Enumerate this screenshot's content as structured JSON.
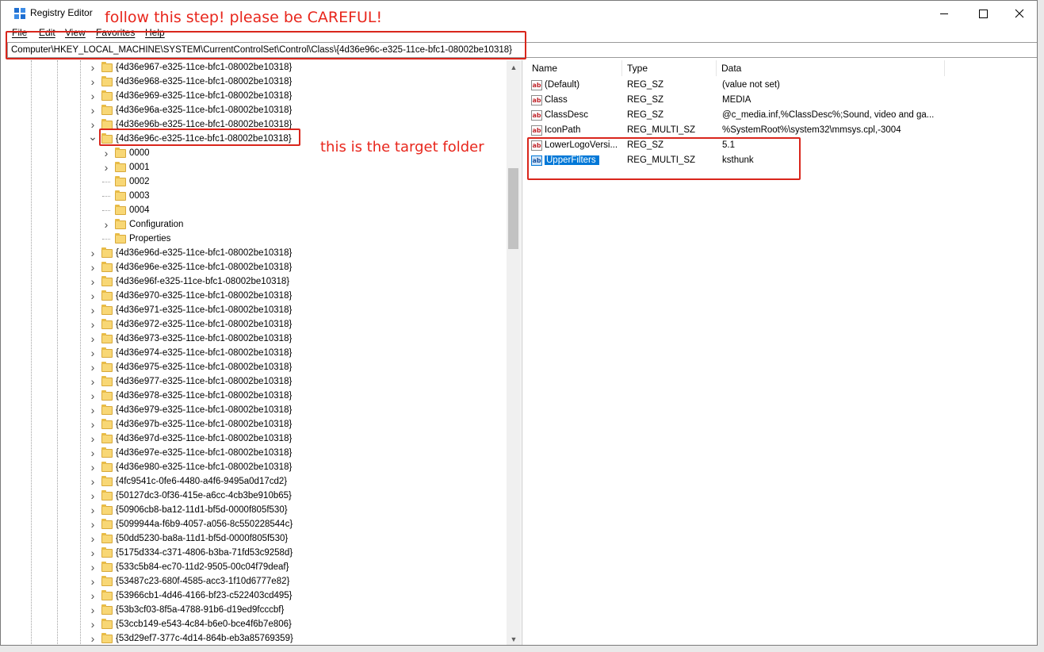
{
  "window": {
    "title": "Registry Editor"
  },
  "annotations": {
    "top_note": "follow this step!  please be CAREFUL!",
    "target_note": "this is the target folder"
  },
  "menu": [
    "File",
    "Edit",
    "View",
    "Favorites",
    "Help"
  ],
  "address": "Computer\\HKEY_LOCAL_MACHINE\\SYSTEM\\CurrentControlSet\\Control\\Class\\{4d36e96c-e325-11ce-bfc1-08002be10318}",
  "tree": [
    {
      "label": "{4d36e967-e325-11ce-bfc1-08002be10318}",
      "level": 1,
      "expander": ">"
    },
    {
      "label": "{4d36e968-e325-11ce-bfc1-08002be10318}",
      "level": 1,
      "expander": ">"
    },
    {
      "label": "{4d36e969-e325-11ce-bfc1-08002be10318}",
      "level": 1,
      "expander": ">"
    },
    {
      "label": "{4d36e96a-e325-11ce-bfc1-08002be10318}",
      "level": 1,
      "expander": ">"
    },
    {
      "label": "{4d36e96b-e325-11ce-bfc1-08002be10318}",
      "level": 1,
      "expander": ">"
    },
    {
      "label": "{4d36e96c-e325-11ce-bfc1-08002be10318}",
      "level": 1,
      "expander": "v",
      "target": true
    },
    {
      "label": "0000",
      "level": 2,
      "expander": ">"
    },
    {
      "label": "0001",
      "level": 2,
      "expander": ">"
    },
    {
      "label": "0002",
      "level": 2,
      "expander": ""
    },
    {
      "label": "0003",
      "level": 2,
      "expander": ""
    },
    {
      "label": "0004",
      "level": 2,
      "expander": ""
    },
    {
      "label": "Configuration",
      "level": 2,
      "expander": ">"
    },
    {
      "label": "Properties",
      "level": 2,
      "expander": ""
    },
    {
      "label": "{4d36e96d-e325-11ce-bfc1-08002be10318}",
      "level": 1,
      "expander": ">"
    },
    {
      "label": "{4d36e96e-e325-11ce-bfc1-08002be10318}",
      "level": 1,
      "expander": ">"
    },
    {
      "label": "{4d36e96f-e325-11ce-bfc1-08002be10318}",
      "level": 1,
      "expander": ">"
    },
    {
      "label": "{4d36e970-e325-11ce-bfc1-08002be10318}",
      "level": 1,
      "expander": ">"
    },
    {
      "label": "{4d36e971-e325-11ce-bfc1-08002be10318}",
      "level": 1,
      "expander": ">"
    },
    {
      "label": "{4d36e972-e325-11ce-bfc1-08002be10318}",
      "level": 1,
      "expander": ">"
    },
    {
      "label": "{4d36e973-e325-11ce-bfc1-08002be10318}",
      "level": 1,
      "expander": ">"
    },
    {
      "label": "{4d36e974-e325-11ce-bfc1-08002be10318}",
      "level": 1,
      "expander": ">"
    },
    {
      "label": "{4d36e975-e325-11ce-bfc1-08002be10318}",
      "level": 1,
      "expander": ">"
    },
    {
      "label": "{4d36e977-e325-11ce-bfc1-08002be10318}",
      "level": 1,
      "expander": ">"
    },
    {
      "label": "{4d36e978-e325-11ce-bfc1-08002be10318}",
      "level": 1,
      "expander": ">"
    },
    {
      "label": "{4d36e979-e325-11ce-bfc1-08002be10318}",
      "level": 1,
      "expander": ">"
    },
    {
      "label": "{4d36e97b-e325-11ce-bfc1-08002be10318}",
      "level": 1,
      "expander": ">"
    },
    {
      "label": "{4d36e97d-e325-11ce-bfc1-08002be10318}",
      "level": 1,
      "expander": ">"
    },
    {
      "label": "{4d36e97e-e325-11ce-bfc1-08002be10318}",
      "level": 1,
      "expander": ">"
    },
    {
      "label": "{4d36e980-e325-11ce-bfc1-08002be10318}",
      "level": 1,
      "expander": ">"
    },
    {
      "label": "{4fc9541c-0fe6-4480-a4f6-9495a0d17cd2}",
      "level": 1,
      "expander": ">"
    },
    {
      "label": "{50127dc3-0f36-415e-a6cc-4cb3be910b65}",
      "level": 1,
      "expander": ">"
    },
    {
      "label": "{50906cb8-ba12-11d1-bf5d-0000f805f530}",
      "level": 1,
      "expander": ">"
    },
    {
      "label": "{5099944a-f6b9-4057-a056-8c550228544c}",
      "level": 1,
      "expander": ">"
    },
    {
      "label": "{50dd5230-ba8a-11d1-bf5d-0000f805f530}",
      "level": 1,
      "expander": ">"
    },
    {
      "label": "{5175d334-c371-4806-b3ba-71fd53c9258d}",
      "level": 1,
      "expander": ">"
    },
    {
      "label": "{533c5b84-ec70-11d2-9505-00c04f79deaf}",
      "level": 1,
      "expander": ">"
    },
    {
      "label": "{53487c23-680f-4585-acc3-1f10d6777e82}",
      "level": 1,
      "expander": ">"
    },
    {
      "label": "{53966cb1-4d46-4166-bf23-c522403cd495}",
      "level": 1,
      "expander": ">"
    },
    {
      "label": "{53b3cf03-8f5a-4788-91b6-d19ed9fcccbf}",
      "level": 1,
      "expander": ">"
    },
    {
      "label": "{53ccb149-e543-4c84-b6e0-bce4f6b7e806}",
      "level": 1,
      "expander": ">"
    },
    {
      "label": "{53d29ef7-377c-4d14-864b-eb3a85769359}",
      "level": 1,
      "expander": ">"
    }
  ],
  "list": {
    "columns": [
      "Name",
      "Type",
      "Data"
    ],
    "rows": [
      {
        "name": "(Default)",
        "type": "REG_SZ",
        "data": "(value not set)",
        "icon": "ab"
      },
      {
        "name": "Class",
        "type": "REG_SZ",
        "data": "MEDIA",
        "icon": "ab"
      },
      {
        "name": "ClassDesc",
        "type": "REG_SZ",
        "data": "@c_media.inf,%ClassDesc%;Sound, video and ga...",
        "icon": "ab"
      },
      {
        "name": "IconPath",
        "type": "REG_MULTI_SZ",
        "data": "%SystemRoot%\\system32\\mmsys.cpl,-3004",
        "icon": "ab"
      },
      {
        "name": "LowerLogoVersi...",
        "type": "REG_SZ",
        "data": "5.1",
        "icon": "ab"
      },
      {
        "name": "UpperFilters",
        "type": "REG_MULTI_SZ",
        "data": "ksthunk",
        "icon": "ab",
        "selected": true
      }
    ]
  }
}
